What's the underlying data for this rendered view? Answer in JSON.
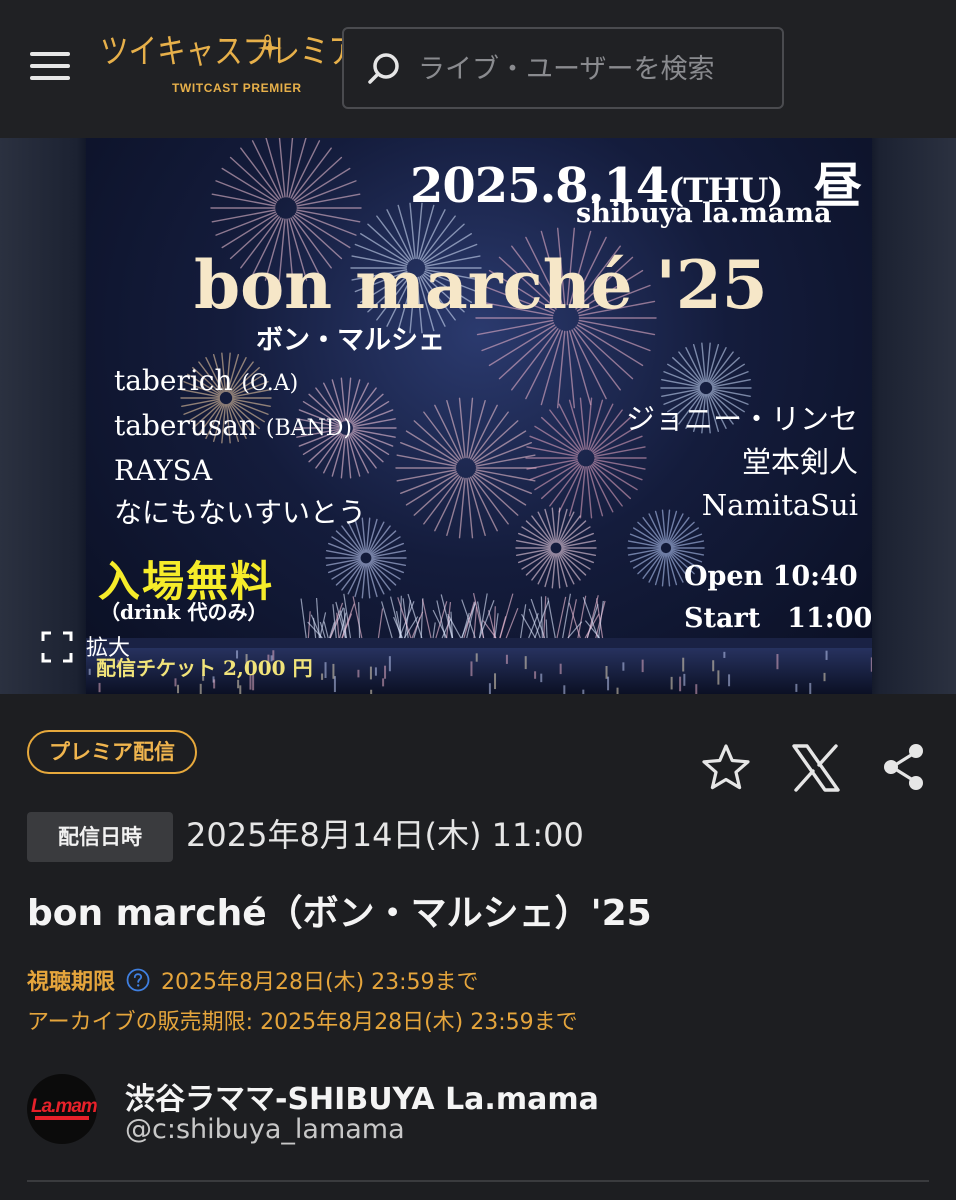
{
  "header": {
    "logo_text": "ツイキャスプレミア",
    "logo_sub": "TWITCAST PREMIER",
    "search_placeholder": "ライブ・ユーザーを検索",
    "icons": {
      "menu": "hamburger-menu-icon",
      "search": "search-icon"
    }
  },
  "hero": {
    "poster": {
      "date": "2025.8.14",
      "weekday": "(THU)",
      "period": "昼",
      "venue": "shibuya la.mama",
      "title": "bon marché '25",
      "title_kana": "ボン・マルシェ",
      "lineup_left": [
        "taberich",
        "(O.A)",
        "taberusan",
        "(BAND)",
        "RAYSA",
        "なにもないすいとう"
      ],
      "lineup_right": [
        "ジョニー・リンセ",
        "堂本剣人",
        "NamitaSui"
      ],
      "free_entry": "入場無料",
      "drink_note": "（drink 代のみ）",
      "ticket_label": "配信チケット",
      "ticket_price": "2,000",
      "ticket_unit": "円",
      "open_time": "Open 10:40",
      "start_time": "Start　11:00"
    },
    "expand_label": "拡大"
  },
  "details": {
    "badge": "プレミア配信",
    "actions": [
      {
        "name": "favorite-star-icon"
      },
      {
        "name": "x-share-icon"
      },
      {
        "name": "share-icon"
      }
    ],
    "date_label": "配信日時",
    "date_value": "2025年8月14日(木) 11:00",
    "title": "bon marché（ボン・マルシェ）'25",
    "view_limit_label": "視聴期限",
    "view_limit_value": "2025年8月28日(木) 23:59まで",
    "archive_limit": "アーカイブの販売期限: 2025年8月28日(木) 23:59まで"
  },
  "channel": {
    "avatar_text": "La.mama",
    "name": "渋谷ラママ-SHIBUYA La.mama",
    "handle": "@c:shibuya_lamama"
  },
  "colors": {
    "background": "#1d1e21",
    "accent_orange": "#e5a53c",
    "poster_yellow": "#f6ec2a"
  }
}
